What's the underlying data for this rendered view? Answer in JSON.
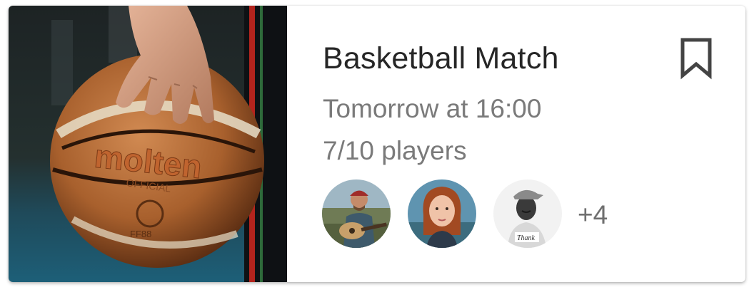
{
  "card": {
    "title": "Basketball Match",
    "time": "Tomorrow at 16:00",
    "players": "7/10 players",
    "more_count": "+4",
    "image": "basketball-photo",
    "bookmark_icon": "bookmark-icon",
    "avatars": [
      {
        "name": "avatar-guitar-player"
      },
      {
        "name": "avatar-red-haired-woman"
      },
      {
        "name": "avatar-man-with-cap"
      }
    ]
  },
  "colors": {
    "title": "#262626",
    "subtitle": "#7a7a7a",
    "bookmark": "#444444",
    "background": "#ffffff"
  }
}
